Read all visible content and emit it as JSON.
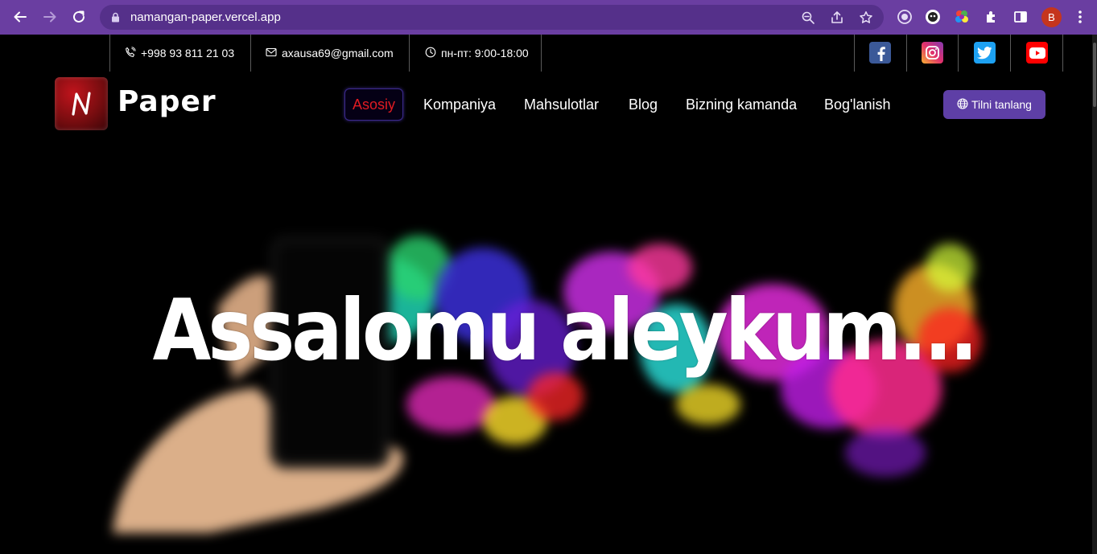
{
  "browser": {
    "url": "namangan-paper.vercel.app",
    "avatar_letter": "B",
    "icons": [
      "back-icon",
      "forward-icon",
      "reload-icon",
      "lock-icon",
      "zoom-icon",
      "share-icon",
      "star-icon",
      "extension-circle-icon",
      "extension-face-icon",
      "extension-color-icon",
      "puzzle-icon",
      "sidebar-icon",
      "menu-dots-icon"
    ]
  },
  "contact": {
    "phone": "+998 93 811 21 03",
    "email": "axausa69@gmail.com",
    "hours": "пн-пт: 9:00-18:00"
  },
  "social": [
    {
      "name": "facebook",
      "color": "#3b5998"
    },
    {
      "name": "instagram",
      "color": "#e1306c"
    },
    {
      "name": "twitter",
      "color": "#1da1f2"
    },
    {
      "name": "youtube",
      "color": "#ff0000"
    }
  ],
  "header": {
    "logo_letter": "N",
    "logo_text": "Paper",
    "nav": [
      {
        "label": "Asosiy",
        "active": true
      },
      {
        "label": "Kompaniya",
        "active": false
      },
      {
        "label": "Mahsulotlar",
        "active": false
      },
      {
        "label": "Blog",
        "active": false
      },
      {
        "label": "Bizning kamanda",
        "active": false
      },
      {
        "label": "Bog'lanish",
        "active": false
      }
    ],
    "language_button": "Tilni tanlang"
  },
  "hero": {
    "title": "Assalomu aleykum..."
  },
  "colors": {
    "browser_frame": "#6a3ea1",
    "active_nav": "#e01b22",
    "lang_button": "#5e3fa6",
    "logo_red": "#c0141c"
  }
}
